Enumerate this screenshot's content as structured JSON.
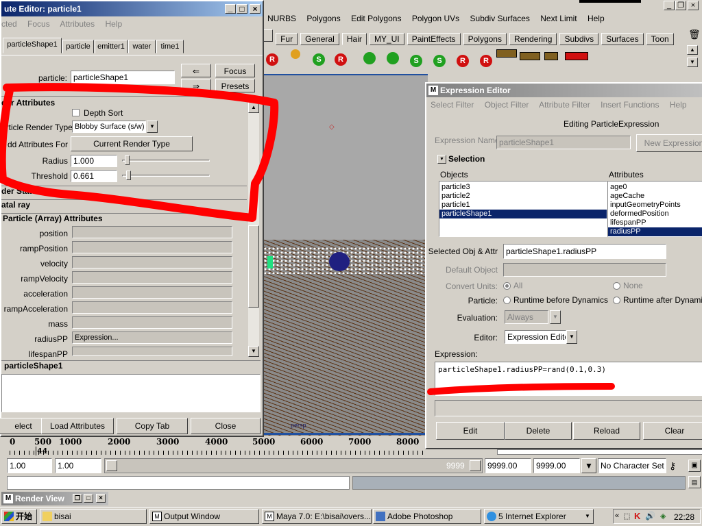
{
  "maya_menu": [
    "NURBS",
    "Polygons",
    "Edit Polygons",
    "Polygon UVs",
    "Subdiv Surfaces",
    "Next Limit",
    "Help"
  ],
  "shelf_tabs": [
    "Fur",
    "General",
    "Hair",
    "MY_UI",
    "PaintEffects",
    "Polygons",
    "Rendering",
    "Subdivs",
    "Surfaces",
    "Toon"
  ],
  "shelf_active": "Hair",
  "timeline": {
    "ticks": [
      "0",
      "500",
      "1000",
      "2000",
      "3000",
      "4000",
      "5000",
      "6000",
      "7000",
      "8000"
    ],
    "current": "44"
  },
  "range": {
    "start": "1.00",
    "start2": "1.00",
    "end_inner": "9999",
    "end": "9999.00",
    "end2": "9999.00",
    "charset": "No Character Set"
  },
  "attr_editor": {
    "title": "ute Editor: particle1",
    "menu": [
      "cted",
      "Focus",
      "Attributes",
      "Help"
    ],
    "tabs": [
      "particleShape1",
      "particle",
      "emitter1",
      "water",
      "time1"
    ],
    "particle_label": "particle:",
    "particle_value": "particleShape1",
    "focus_btn": "Focus",
    "presets_btn": "Presets",
    "section_render": "der Attributes",
    "depth_sort": "Depth Sort",
    "render_type_label": "article Render Type",
    "render_type_value": "Blobby Surface (s/w)",
    "add_attr_label": "dd Attributes For",
    "current_render_type_btn": "Current Render Type",
    "radius_label": "Radius",
    "radius_value": "1.000",
    "threshold_label": "Threshold",
    "threshold_value": "0.661",
    "render_stats": "der Stats",
    "ray": "atal ray",
    "per_particle": "Particle (Array) Attributes",
    "array_attrs": [
      {
        "name": "position",
        "value": ""
      },
      {
        "name": "rampPosition",
        "value": ""
      },
      {
        "name": "velocity",
        "value": ""
      },
      {
        "name": "rampVelocity",
        "value": ""
      },
      {
        "name": "acceleration",
        "value": ""
      },
      {
        "name": "rampAcceleration",
        "value": ""
      },
      {
        "name": "mass",
        "value": ""
      },
      {
        "name": "radiusPP",
        "value": "Expression..."
      },
      {
        "name": "lifespanPP",
        "value": ""
      }
    ],
    "notes_label": "particleShape1",
    "buttons": [
      "elect",
      "Load Attributes",
      "Copy Tab",
      "Close"
    ]
  },
  "expr_editor": {
    "title": "Expression Editor",
    "menu": [
      "Select Filter",
      "Object Filter",
      "Attribute Filter",
      "Insert Functions",
      "Help"
    ],
    "editing": "Editing ParticleExpression",
    "name_label": "Expression Name",
    "name_value": "particleShape1",
    "new_expr_btn": "New Expression",
    "selection_label": "Selection",
    "objects_label": "Objects",
    "attributes_label": "Attributes",
    "objects": [
      "particle3",
      "particle2",
      "particle1",
      "particleShape1"
    ],
    "objects_selected": "particleShape1",
    "attributes": [
      "age0",
      "ageCache",
      "inputGeometryPoints",
      "deformedPosition",
      "lifespanPP",
      "radiusPP"
    ],
    "attributes_selected": "radiusPP",
    "sel_obj_label": "Selected Obj & Attr",
    "sel_obj_value": "particleShape1.radiusPP",
    "default_obj_label": "Default Object",
    "convert_label": "Convert Units:",
    "convert_all": "All",
    "convert_none": "None",
    "particle_label": "Particle:",
    "runtime_before": "Runtime before Dynamics",
    "runtime_after": "Runtime after Dynamics",
    "evaluation_label": "Evaluation:",
    "evaluation_value": "Always",
    "editor_label": "Editor:",
    "editor_value": "Expression Editor",
    "expression_label": "Expression:",
    "expression_text": "particleShape1.radiusPP=rand(0.1,0.3)",
    "buttons": [
      "Edit",
      "Delete",
      "Reload",
      "Clear"
    ]
  },
  "render_view": {
    "title": "Render View"
  },
  "viewport": {
    "label": "persp"
  },
  "taskbar": {
    "start": "开始",
    "items": [
      "bisai",
      "Output Window",
      "Maya 7.0: E:\\bisai\\overs...",
      "Adobe Photoshop",
      "5 Internet Explorer"
    ],
    "clock": "22:28"
  },
  "colors": {
    "selection": "#0a246a",
    "annotation": "#ff0000",
    "title_active": "#0a246a"
  }
}
